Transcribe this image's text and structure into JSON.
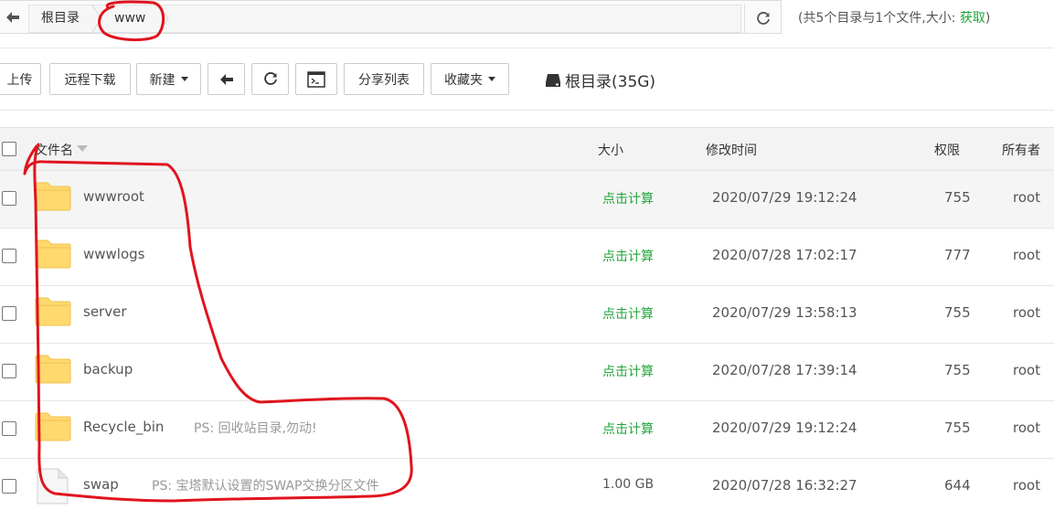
{
  "path_bar": {
    "crumbs": [
      "根目录",
      "www"
    ],
    "dir_summary": "(共5个目录与1个文件,大小:",
    "fetch_link": "获取",
    "dir_summary_end": ")"
  },
  "toolbar": {
    "upload": "上传",
    "remote_download": "远程下载",
    "new": "新建",
    "share_list": "分享列表",
    "favorites": "收藏夹",
    "disk_label": "根目录(35G)"
  },
  "table": {
    "headers": {
      "name": "文件名",
      "size": "大小",
      "mtime": "修改时间",
      "perm": "权限",
      "owner": "所有者"
    },
    "rows": [
      {
        "name": "wwwroot",
        "note": "",
        "size": "点击计算",
        "mtime": "2020/07/29 19:12:24",
        "perm": "755",
        "owner": "root",
        "type": "folder"
      },
      {
        "name": "wwwlogs",
        "note": "",
        "size": "点击计算",
        "mtime": "2020/07/28 17:02:17",
        "perm": "777",
        "owner": "root",
        "type": "folder"
      },
      {
        "name": "server",
        "note": "",
        "size": "点击计算",
        "mtime": "2020/07/29 13:58:13",
        "perm": "755",
        "owner": "root",
        "type": "folder"
      },
      {
        "name": "backup",
        "note": "",
        "size": "点击计算",
        "mtime": "2020/07/28 17:39:14",
        "perm": "755",
        "owner": "root",
        "type": "folder"
      },
      {
        "name": "Recycle_bin",
        "note": "PS: 回收站目录,勿动!",
        "size": "点击计算",
        "mtime": "2020/07/29 19:12:24",
        "perm": "755",
        "owner": "root",
        "type": "folder"
      },
      {
        "name": "swap",
        "note": "PS: 宝塔默认设置的SWAP交换分区文件",
        "size": "1.00 GB",
        "mtime": "2020/07/28 16:32:27",
        "perm": "644",
        "owner": "root",
        "type": "file"
      }
    ]
  },
  "colors": {
    "accent_green": "#20a53a",
    "folder_yellow": "#ffd86e",
    "annotation_red": "#e0141e"
  },
  "icons": [
    "back-arrow-icon",
    "refresh-icon",
    "terminal-icon",
    "disk-icon",
    "folder-icon",
    "file-icon",
    "chevron-down-icon",
    "sort-caret-icon"
  ]
}
